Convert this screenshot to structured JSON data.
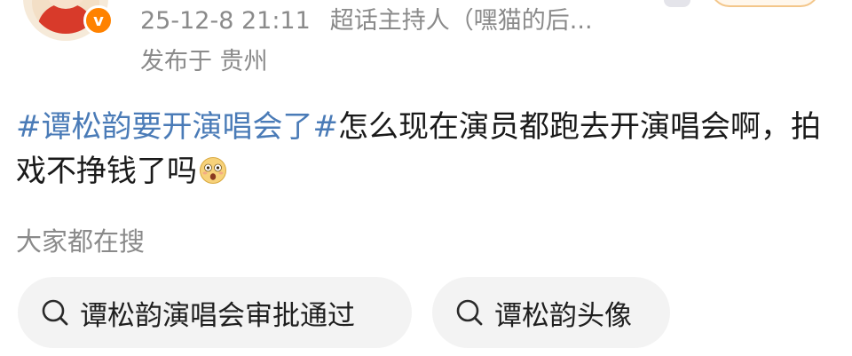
{
  "post": {
    "timestamp": "25-12-8 21:11",
    "role": "超话主持人（嘿猫的后...",
    "location": "发布于 贵州",
    "topic": "#谭松韵要开演唱会了#",
    "text": "怎么现在演员都跑去开演唱会啊，拍戏不挣钱了吗",
    "emoji": "astonished-face-emoji",
    "verified_badge": "v"
  },
  "search_section": {
    "title": "大家都在搜",
    "items": [
      {
        "label": "谭松韵演唱会审批通过",
        "icon": "search-icon"
      },
      {
        "label": "谭松韵头像",
        "icon": "search-icon"
      }
    ]
  },
  "colors": {
    "topic": "#4a7bb7",
    "meta": "#8a8a8a",
    "badge": "#ff8200",
    "chip_bg": "#f3f3f3"
  }
}
